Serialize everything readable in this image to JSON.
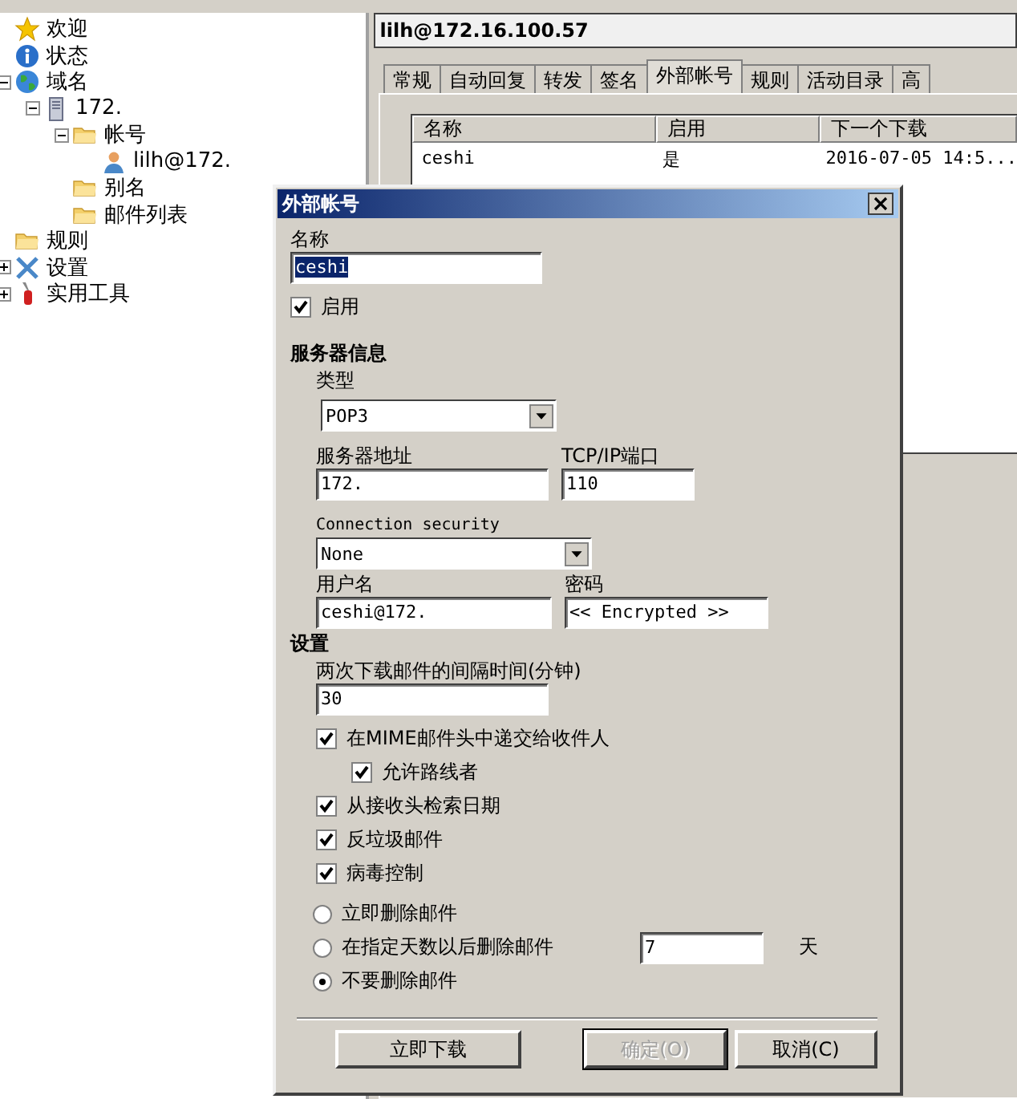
{
  "tree": [
    {
      "label": "欢迎",
      "kind": "star"
    },
    {
      "label": "状态",
      "kind": "info"
    },
    {
      "label": "域名",
      "kind": "globe",
      "expanded": true,
      "children": [
        {
          "label": "172.",
          "kind": "server",
          "expanded": true,
          "children": [
            {
              "label": "帐号",
              "kind": "folder",
              "expanded": true,
              "children": [
                {
                  "label": "lilh@172.",
                  "kind": "user"
                }
              ]
            },
            {
              "label": "别名",
              "kind": "folder"
            },
            {
              "label": "邮件列表",
              "kind": "folder"
            }
          ]
        }
      ]
    },
    {
      "label": "规则",
      "kind": "folder"
    },
    {
      "label": "设置",
      "kind": "tools",
      "expanded": false
    },
    {
      "label": "实用工具",
      "kind": "utility",
      "expanded": false
    }
  ],
  "account_header": "lilh@172.16.100.57",
  "tabs": [
    {
      "label": "常规",
      "selected": false
    },
    {
      "label": "自动回复",
      "selected": false
    },
    {
      "label": "转发",
      "selected": false
    },
    {
      "label": "签名",
      "selected": false
    },
    {
      "label": "外部帐号",
      "selected": true
    },
    {
      "label": "规则",
      "selected": false
    },
    {
      "label": "活动目录",
      "selected": false
    },
    {
      "label": "高",
      "selected": false
    }
  ],
  "accounts_list": {
    "columns": [
      "名称",
      "启用",
      "下一个下载"
    ],
    "rows": [
      {
        "cells": [
          "ceshi",
          "是",
          "2016-07-05 14:5..."
        ]
      }
    ]
  },
  "dialog": {
    "title": "外部帐号",
    "name": {
      "label": "名称",
      "value": "ceshi",
      "text_selected": true
    },
    "enabled": {
      "label": "启用",
      "checked": true
    },
    "server_section": "服务器信息",
    "type": {
      "label": "类型",
      "value": "POP3"
    },
    "address": {
      "label": "服务器地址",
      "value": "172."
    },
    "port": {
      "label": "TCP/IP端口",
      "value": "110"
    },
    "security": {
      "label": "Connection security",
      "value": "None"
    },
    "username": {
      "label": "用户名",
      "value": "ceshi@172."
    },
    "password": {
      "label": "密码",
      "value": "<< Encrypted >>"
    },
    "settings_section": "设置",
    "interval": {
      "label": "两次下载邮件的间隔时间(分钟)",
      "value": "30"
    },
    "options": [
      {
        "label": "在MIME邮件头中递交给收件人",
        "checked": true,
        "children": [
          {
            "label": "允许路线者",
            "checked": true
          }
        ]
      },
      {
        "label": "从接收头检索日期",
        "checked": true
      },
      {
        "label": "反垃圾邮件",
        "checked": true
      },
      {
        "label": "病毒控制",
        "checked": true
      }
    ],
    "delete_modes": [
      {
        "label": "立即删除邮件",
        "selected": false
      },
      {
        "label": "在指定天数以后删除邮件",
        "selected": false,
        "days": "7",
        "unit": "天"
      },
      {
        "label": "不要删除邮件",
        "selected": true
      }
    ],
    "buttons": [
      {
        "label": "立即下载",
        "disabled": false,
        "default": false
      },
      {
        "label": "确定(O)",
        "disabled": true,
        "default": true
      },
      {
        "label": "取消(C)",
        "disabled": false,
        "default": false
      }
    ]
  }
}
